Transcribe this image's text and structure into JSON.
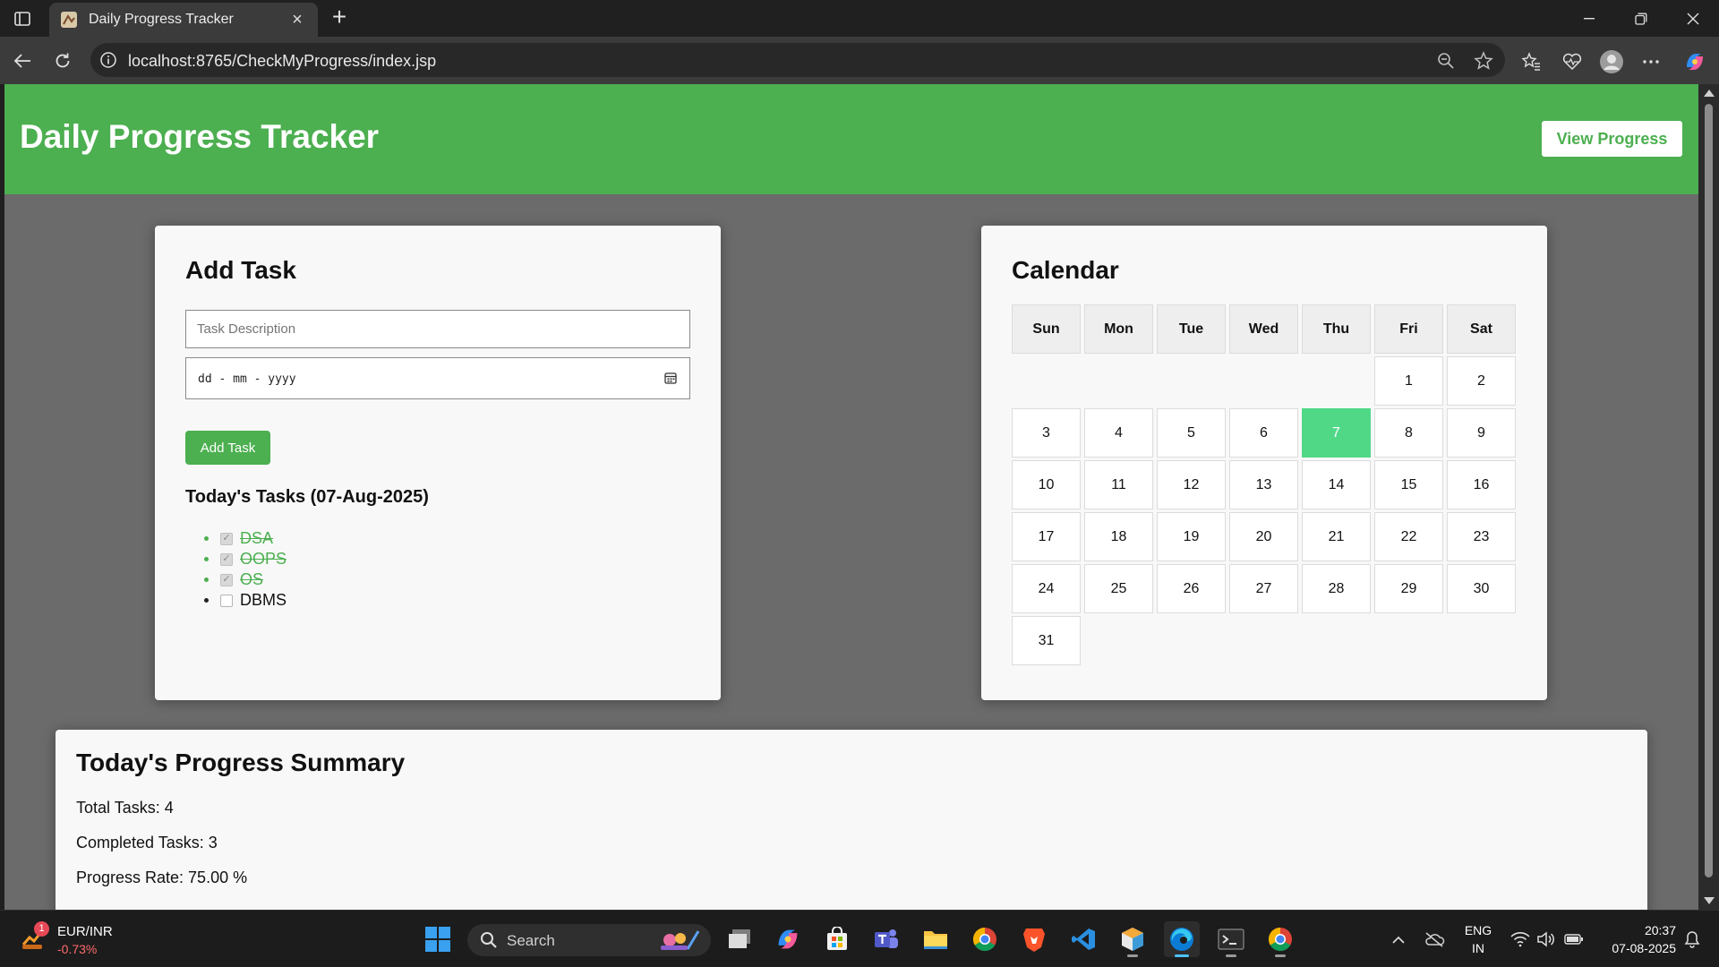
{
  "browser": {
    "tab_title": "Daily Progress Tracker",
    "new_tab_symbol": "+",
    "close_tab_symbol": "×",
    "url": "localhost:8765/CheckMyProgress/index.jsp"
  },
  "header": {
    "title": "Daily Progress Tracker",
    "view_progress_label": "View Progress",
    "accent_color": "#4caf50"
  },
  "add_task": {
    "heading": "Add Task",
    "description_placeholder": "Task Description",
    "date_placeholder": "dd - mm - yyyy",
    "button_label": "Add Task",
    "tasks_heading": "Today's Tasks (07-Aug-2025)",
    "tasks": [
      {
        "name": "DSA",
        "completed": true
      },
      {
        "name": "OOPS",
        "completed": true
      },
      {
        "name": "OS",
        "completed": true
      },
      {
        "name": "DBMS",
        "completed": false
      }
    ]
  },
  "calendar": {
    "heading": "Calendar",
    "weekdays": [
      "Sun",
      "Mon",
      "Tue",
      "Wed",
      "Thu",
      "Fri",
      "Sat"
    ],
    "first_weekday_index": 5,
    "days_in_month": 31,
    "today": 7,
    "today_color": "#50d887"
  },
  "summary": {
    "heading": "Today's Progress Summary",
    "total_tasks": "Total Tasks: 4",
    "completed_tasks": "Completed Tasks: 3",
    "progress_rate": "Progress Rate: 75.00 %"
  },
  "taskbar": {
    "ticker_name": "EUR/INR",
    "ticker_change": "-0.73%",
    "notification_count": "1",
    "search_label": "Search",
    "language_line1": "ENG",
    "language_line2": "IN",
    "time": "20:37",
    "date": "07-08-2025"
  }
}
